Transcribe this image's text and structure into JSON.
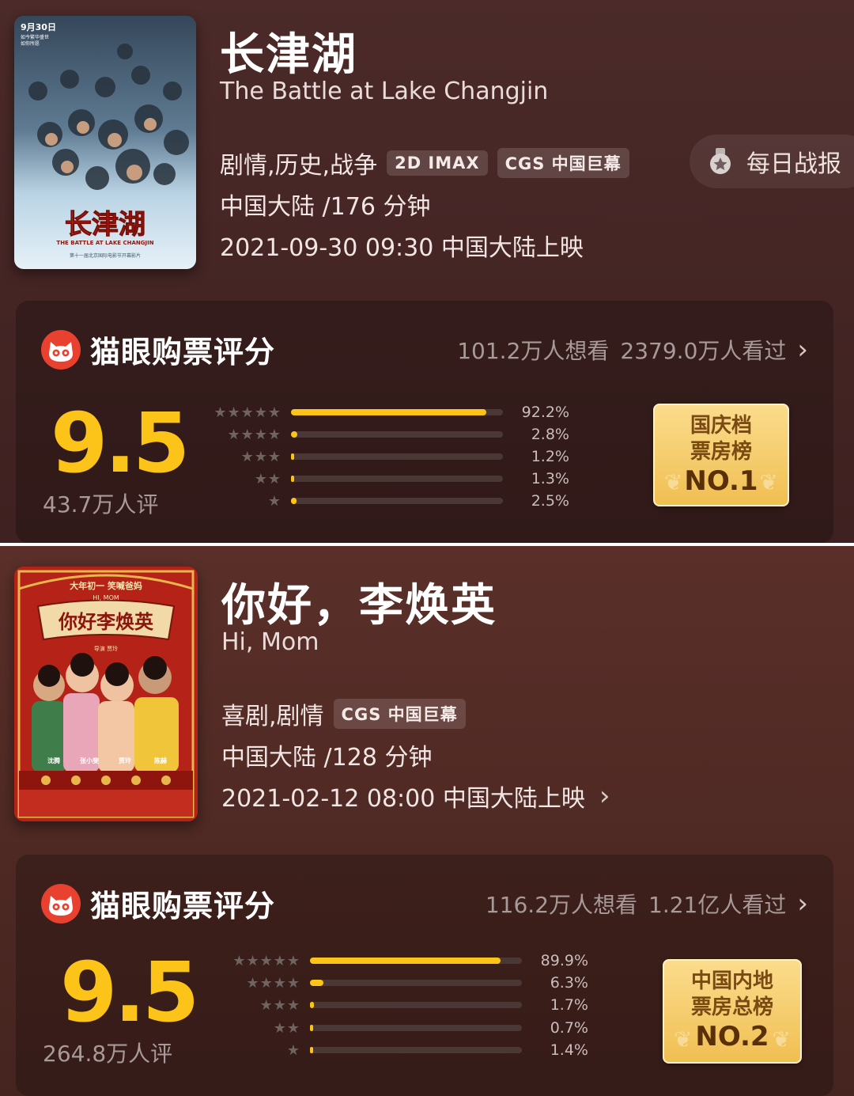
{
  "movies": [
    {
      "title": "长津湖",
      "subtitle": "The Battle at Lake Changjin",
      "genres": "剧情,历史,战争",
      "tags": [
        "2D IMAX",
        "CGS 中国巨幕"
      ],
      "region_duration": "中国大陆 /176 分钟",
      "release": "2021-09-30 09:30 中国大陆上映",
      "poster": {
        "date_text": "9月30日",
        "top_line": "如今繁华盛世",
        "top_line2": "如你所愿",
        "logo": "长津湖",
        "subtitle": "THE BATTLE AT LAKE CHANGJIN",
        "footer": "第十一届北京国际电影节开幕影片"
      },
      "daily_report": "每日战报",
      "rating": {
        "brand": "猫眼购票评分",
        "want": "101.2万人想看",
        "watched": "2379.0万人看过",
        "score": "9.5",
        "raters": "43.7万人评",
        "distribution": [
          {
            "stars": 5,
            "percent": 92.2,
            "label": "92.2%"
          },
          {
            "stars": 4,
            "percent": 2.8,
            "label": "2.8%"
          },
          {
            "stars": 3,
            "percent": 1.2,
            "label": "1.2%"
          },
          {
            "stars": 2,
            "percent": 1.3,
            "label": "1.3%"
          },
          {
            "stars": 1,
            "percent": 2.5,
            "label": "2.5%"
          }
        ],
        "rank_line1": "国庆档",
        "rank_line2": "票房榜",
        "rank_num": "NO.1"
      }
    },
    {
      "title": "你好，李焕英",
      "subtitle": "Hi, Mom",
      "genres": "喜剧,剧情",
      "tags": [
        "CGS 中国巨幕"
      ],
      "region_duration": "中国大陆 /128 分钟",
      "release": "2021-02-12 08:00 中国大陆上映",
      "poster": {
        "top_line": "大年初一 笑喊爸妈",
        "english": "HI, MOM",
        "logo": "你好李焕英",
        "director": "导演 贾玲",
        "cast": [
          "沈腾",
          "张小斐",
          "贾玲",
          "陈赫"
        ]
      },
      "rating": {
        "brand": "猫眼购票评分",
        "want": "116.2万人想看",
        "watched": "1.21亿人看过",
        "score": "9.5",
        "raters": "264.8万人评",
        "distribution": [
          {
            "stars": 5,
            "percent": 89.9,
            "label": "89.9%"
          },
          {
            "stars": 4,
            "percent": 6.3,
            "label": "6.3%"
          },
          {
            "stars": 3,
            "percent": 1.7,
            "label": "1.7%"
          },
          {
            "stars": 2,
            "percent": 0.7,
            "label": "0.7%"
          },
          {
            "stars": 1,
            "percent": 1.4,
            "label": "1.4%"
          }
        ],
        "rank_line1": "中国内地",
        "rank_line2": "票房总榜",
        "rank_num": "NO.2"
      }
    }
  ],
  "colors": {
    "accent": "#fcc419",
    "panel1_bg": "#4b2a29",
    "panel2_bg": "#5a2f29",
    "brand_red": "#e8412f"
  }
}
